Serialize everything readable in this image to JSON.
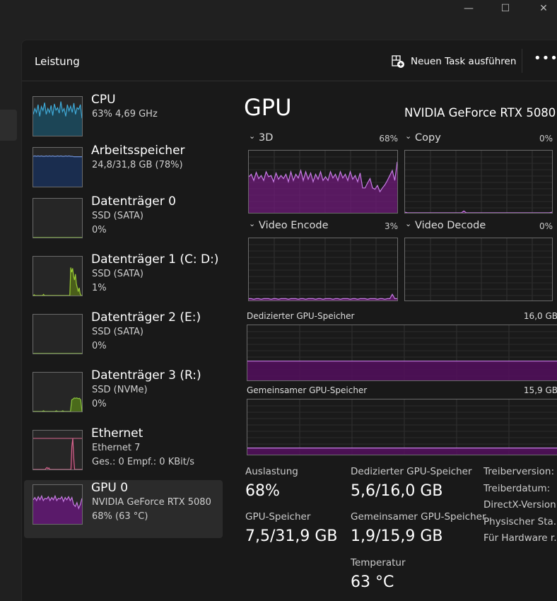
{
  "window": {
    "minimize_icon": "minimize-icon",
    "maximize_icon": "maximize-icon",
    "close_icon": "close-icon"
  },
  "header": {
    "title": "Leistung",
    "new_task_label": "Neuen Task ausführen",
    "more_label": "•••"
  },
  "sidebar": {
    "items": [
      {
        "name": "CPU",
        "sub1": "63%  4,69 GHz",
        "sub2": "",
        "color": "#3fa9d6",
        "fill": "#1c4556",
        "history": [
          55,
          70,
          60,
          80,
          50,
          75,
          65,
          85,
          55,
          70,
          60,
          78,
          52,
          82,
          66,
          72,
          58,
          88,
          62,
          70,
          50,
          80,
          64,
          76,
          60,
          84,
          55,
          72,
          68,
          80,
          45
        ]
      },
      {
        "name": "Arbeitsspeicher",
        "sub1": "24,8/31,8 GB (78%)",
        "sub2": "",
        "color": "#6e8fd2",
        "fill": "#1a2d4f",
        "history": [
          78,
          79,
          78,
          79,
          78,
          79,
          78,
          78,
          79,
          78,
          79,
          78,
          79,
          78,
          78,
          79,
          78,
          79,
          78,
          78,
          79,
          78,
          79,
          78,
          78,
          77,
          77,
          77,
          77,
          77,
          77
        ]
      },
      {
        "name": "Datenträger 0",
        "sub1": "SSD (SATA)",
        "sub2": "0%",
        "color": "#8cc63f",
        "fill": "#34471a",
        "history": [
          0,
          0,
          0,
          0,
          0,
          0,
          0,
          0,
          0,
          0,
          0,
          0,
          0,
          0,
          0,
          0,
          0,
          0,
          0,
          0,
          0,
          0,
          0,
          0,
          0,
          0,
          0,
          0,
          0,
          0,
          0
        ]
      },
      {
        "name": "Datenträger 1 (C: D:)",
        "sub1": "SSD (SATA)",
        "sub2": "1%",
        "color": "#9acd32",
        "fill": "#4a5e1a",
        "history": [
          0,
          2,
          0,
          0,
          0,
          0,
          0,
          0,
          0,
          0,
          0,
          3,
          0,
          0,
          0,
          0,
          0,
          0,
          0,
          0,
          0,
          0,
          0,
          0,
          0,
          0,
          0,
          0,
          0,
          0,
          0,
          0,
          0,
          0,
          0,
          0,
          0,
          0,
          0,
          0,
          72,
          60,
          70,
          50,
          40,
          55,
          30,
          20,
          10,
          20,
          5,
          0,
          0
        ]
      },
      {
        "name": "Datenträger 2 (E:)",
        "sub1": "SSD (SATA)",
        "sub2": "0%",
        "color": "#8cc63f",
        "fill": "#34471a",
        "history": [
          0,
          0,
          0,
          0,
          0,
          0,
          0,
          0,
          0,
          0,
          0,
          0,
          0,
          0,
          0,
          0,
          0,
          0,
          0,
          0,
          0,
          0,
          0,
          0,
          0,
          0,
          0,
          0,
          0,
          0,
          0
        ]
      },
      {
        "name": "Datenträger 3 (R:)",
        "sub1": "SSD (NVMe)",
        "sub2": "0%",
        "color": "#8cc63f",
        "fill": "#4a6a1a",
        "history": [
          0,
          0,
          0,
          0,
          0,
          0,
          0,
          0,
          2,
          0,
          0,
          0,
          0,
          0,
          0,
          0,
          0,
          0,
          2,
          0,
          0,
          0,
          0,
          2,
          0,
          0,
          0,
          0,
          0,
          0,
          30,
          32,
          35,
          34,
          35,
          33,
          34,
          30,
          0
        ]
      },
      {
        "name": "Ethernet",
        "sub1": "Ethernet 7",
        "sub2": "Ges.: 0  Empf.: 0 KBit/s",
        "color": "#d9658f",
        "fill": "#3a1e2a",
        "history": [
          0,
          0,
          0,
          0,
          0,
          0,
          0,
          0,
          0,
          0,
          0,
          0,
          0,
          0,
          3,
          5,
          2,
          4,
          0,
          0,
          0,
          0,
          0,
          0,
          0,
          0,
          0,
          0,
          0,
          0,
          0,
          0,
          0,
          0,
          0,
          0,
          0,
          0,
          0,
          0,
          0,
          0,
          60,
          80,
          30,
          0,
          0,
          0,
          0,
          0,
          0,
          0,
          0,
          0
        ],
        "scale_line": "#d9658f"
      },
      {
        "name": "GPU 0",
        "sub1": "NVIDIA GeForce RTX 5080",
        "sub2": "68% (63 °C)",
        "color": "#c57ce0",
        "fill": "#5a1a6a",
        "selected": true,
        "history": [
          62,
          68,
          60,
          70,
          62,
          72,
          60,
          66,
          64,
          70,
          60,
          68,
          62,
          72,
          60,
          66,
          64,
          70,
          58,
          68,
          62,
          70,
          60,
          68,
          50,
          45,
          55,
          40,
          50,
          66
        ]
      }
    ]
  },
  "main": {
    "title": "GPU",
    "model": "NVIDIA GeForce RTX 5080",
    "accent": "#9b4fb8",
    "engines": [
      {
        "label": "3D",
        "percent": "68%",
        "history": [
          58,
          62,
          52,
          65,
          55,
          60,
          52,
          66,
          58,
          60,
          50,
          64,
          54,
          60,
          55,
          62,
          50,
          66,
          52,
          62,
          56,
          68,
          52,
          66,
          54,
          64,
          50,
          62,
          54,
          66,
          52,
          58,
          52,
          66,
          56,
          62,
          52,
          66,
          56,
          62,
          52,
          66,
          54,
          60,
          50,
          64,
          40,
          40,
          48,
          55,
          40,
          38,
          44,
          34,
          40,
          45,
          52,
          60,
          68,
          52,
          82
        ]
      },
      {
        "label": "Copy",
        "percent": "0%",
        "history": [
          1,
          0,
          0,
          0,
          0,
          0,
          0,
          0,
          0,
          0,
          0,
          0,
          0,
          0,
          0,
          0,
          0,
          0,
          0,
          0,
          0,
          0,
          0,
          0,
          3,
          0,
          0,
          0,
          0,
          0,
          0,
          0,
          0,
          0,
          0,
          0,
          0,
          0,
          0,
          0,
          0,
          0,
          0,
          0,
          0,
          0,
          0,
          0,
          0,
          0,
          0,
          0,
          0,
          0,
          0,
          0,
          0,
          0,
          0,
          0,
          1
        ]
      },
      {
        "label": "Video Encode",
        "percent": "3%",
        "history": [
          3,
          3,
          2,
          3,
          3,
          2,
          3,
          3,
          3,
          2,
          3,
          3,
          2,
          3,
          3,
          3,
          2,
          3,
          3,
          3,
          2,
          3,
          3,
          2,
          3,
          3,
          3,
          2,
          3,
          3,
          2,
          3,
          3,
          3,
          2,
          3,
          3,
          2,
          3,
          3,
          3,
          2,
          3,
          3,
          2,
          3,
          3,
          3,
          2,
          3,
          3,
          3,
          2,
          3,
          3,
          2,
          3,
          3,
          10,
          3,
          3
        ]
      },
      {
        "label": "Video Decode",
        "percent": "0%",
        "history": []
      }
    ],
    "memory_graphs": [
      {
        "label": "Dedizierter GPU-Speicher",
        "max": "16,0 GB",
        "used_fraction": 0.35
      },
      {
        "label": "Gemeinsamer GPU-Speicher",
        "max": "15,9 GB",
        "used_fraction": 0.12
      }
    ],
    "stats": [
      {
        "label": "Auslastung",
        "value": "68%"
      },
      {
        "label": "GPU-Speicher",
        "value": "7,5/31,9 GB"
      },
      {
        "label": "Dedizierter GPU-Speicher",
        "value": "5,6/16,0 GB"
      },
      {
        "label": "Gemeinsamer GPU-Speicher",
        "value": "1,9/15,9 GB"
      },
      {
        "label": "Temperatur",
        "value": "63 °C"
      }
    ],
    "details": [
      "Treiberversion:",
      "Treiberdatum:",
      "DirectX-Version",
      "Physischer Sta...",
      "Für Hardware r."
    ]
  }
}
